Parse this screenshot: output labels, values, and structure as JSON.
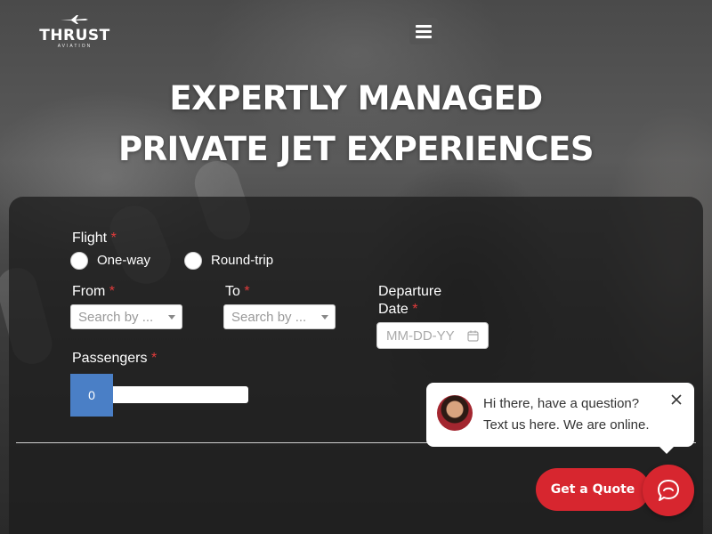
{
  "brand": {
    "name": "THRUST",
    "tagline": "AVIATION",
    "logo_icon": "plane-icon"
  },
  "header": {
    "menu_icon": "hamburger-menu-icon"
  },
  "hero": {
    "title_line1": "EXPERTLY MANAGED",
    "title_line2": "PRIVATE JET EXPERIENCES"
  },
  "form": {
    "flight": {
      "label": "Flight",
      "required_mark": "*",
      "options": [
        "One-way",
        "Round-trip"
      ]
    },
    "from": {
      "label": "From",
      "required_mark": "*",
      "placeholder": "Search by ..."
    },
    "to": {
      "label": "To",
      "required_mark": "*",
      "placeholder": "Search by ..."
    },
    "departure": {
      "label_line1": "Departure",
      "label_line2": "Date",
      "required_mark": "*",
      "placeholder": "MM-DD-YY",
      "icon": "calendar-icon"
    },
    "passengers": {
      "label": "Passengers",
      "required_mark": "*",
      "value": "0"
    }
  },
  "chat": {
    "message_line1": "Hi there, have a question?",
    "message_line2": "Text us here. We are online.",
    "close_icon": "close-icon",
    "launcher_icon": "chat-icon"
  },
  "cta": {
    "quote_label": "Get a Quote"
  },
  "colors": {
    "accent_red": "#d7262f",
    "stepper_blue": "#4a7fc6",
    "required_red": "#e03b3b"
  }
}
